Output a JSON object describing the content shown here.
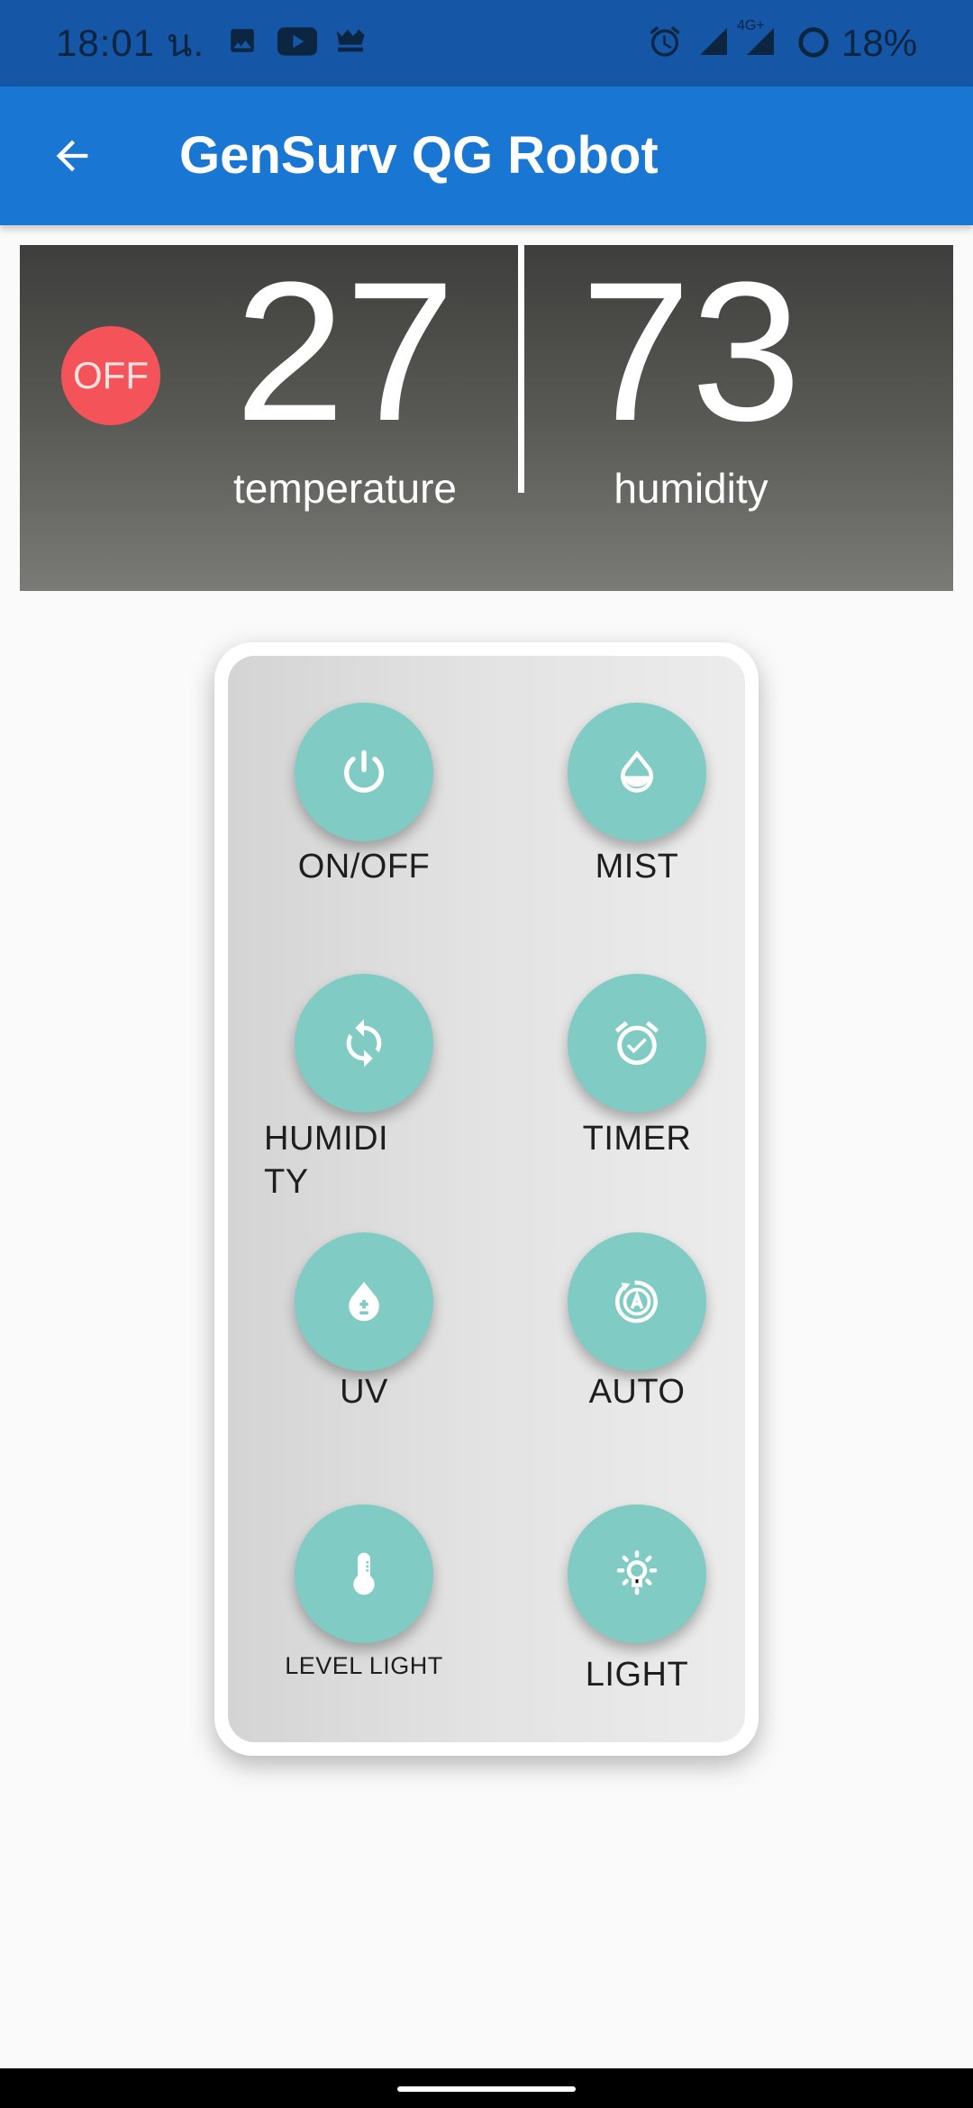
{
  "status_bar": {
    "time": "18:01 น.",
    "battery": "18%",
    "network_label": "4G+",
    "icons": [
      "gallery-icon",
      "youtube-icon",
      "line-app-icon",
      "alarm-icon",
      "signal-icon",
      "signal-icon",
      "battery-saver-icon"
    ]
  },
  "app_bar": {
    "title": "GenSurv QG Robot",
    "back_icon": "arrow-back-icon",
    "color": "#1976d2"
  },
  "sensor_panel": {
    "power_status": "OFF",
    "power_status_color": "#f45459",
    "temperature": {
      "value": "27",
      "label": "temperature"
    },
    "humidity": {
      "value": "73",
      "label": "humidity"
    }
  },
  "controls": [
    {
      "label": "ON/OFF",
      "icon": "power-icon"
    },
    {
      "label": "MIST",
      "icon": "water-drop-icon"
    },
    {
      "label": "HUMIDITY",
      "icon": "sync-icon"
    },
    {
      "label": "TIMER",
      "icon": "alarm-check-icon"
    },
    {
      "label": "UV",
      "icon": "drop-plus-minus-icon"
    },
    {
      "label": "AUTO",
      "icon": "auto-mode-icon"
    },
    {
      "label": "LEVEL LIGHT",
      "icon": "thermometer-icon"
    },
    {
      "label": "LIGHT",
      "icon": "light-bulb-icon"
    }
  ],
  "colors": {
    "button": "#80cbc4",
    "status_bar": "#1556a6"
  }
}
